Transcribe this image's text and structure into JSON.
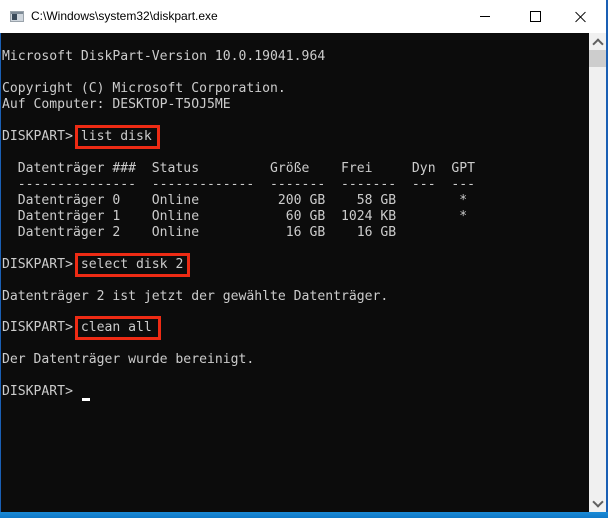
{
  "window": {
    "title": "C:\\Windows\\system32\\diskpart.exe",
    "controls": {
      "minimize": "minimize",
      "maximize": "maximize",
      "close": "close"
    }
  },
  "console": {
    "lines": {
      "version": "Microsoft DiskPart-Version 10.0.19041.964",
      "copyright": "Copyright (C) Microsoft Corporation.",
      "computer": "Auf Computer: DESKTOP-T5OJ5ME",
      "prompt": "DISKPART> ",
      "cmd1": "list disk",
      "table_header": "  Datenträger ###  Status         Größe    Frei     Dyn  GPT",
      "table_sep": "  ---------------  -------------  -------  -------  ---  ---",
      "cmd2": "select disk 2",
      "result2": "Datenträger 2 ist jetzt der gewählte Datenträger.",
      "cmd3": "clean all",
      "result3": "Der Datenträger wurde bereinigt."
    },
    "disk_table": {
      "columns": [
        "Datenträger ###",
        "Status",
        "Größe",
        "Frei",
        "Dyn",
        "GPT"
      ],
      "rows": [
        {
          "name": "Datenträger 0",
          "status": "Online",
          "size": "200 GB",
          "free": "58 GB",
          "dyn": "",
          "gpt": "*",
          "text": "  Datenträger 0    Online          200 GB    58 GB        *"
        },
        {
          "name": "Datenträger 1",
          "status": "Online",
          "size": "60 GB",
          "free": "1024 KB",
          "dyn": "",
          "gpt": "*",
          "text": "  Datenträger 1    Online           60 GB  1024 KB        *"
        },
        {
          "name": "Datenträger 2",
          "status": "Online",
          "size": "16 GB",
          "free": "16 GB",
          "dyn": "",
          "gpt": "",
          "text": "  Datenträger 2    Online           16 GB    16 GB"
        }
      ]
    },
    "highlight_color": "#ee2b14",
    "text_color": "#cccccc",
    "background_color": "#0c0c0c"
  }
}
